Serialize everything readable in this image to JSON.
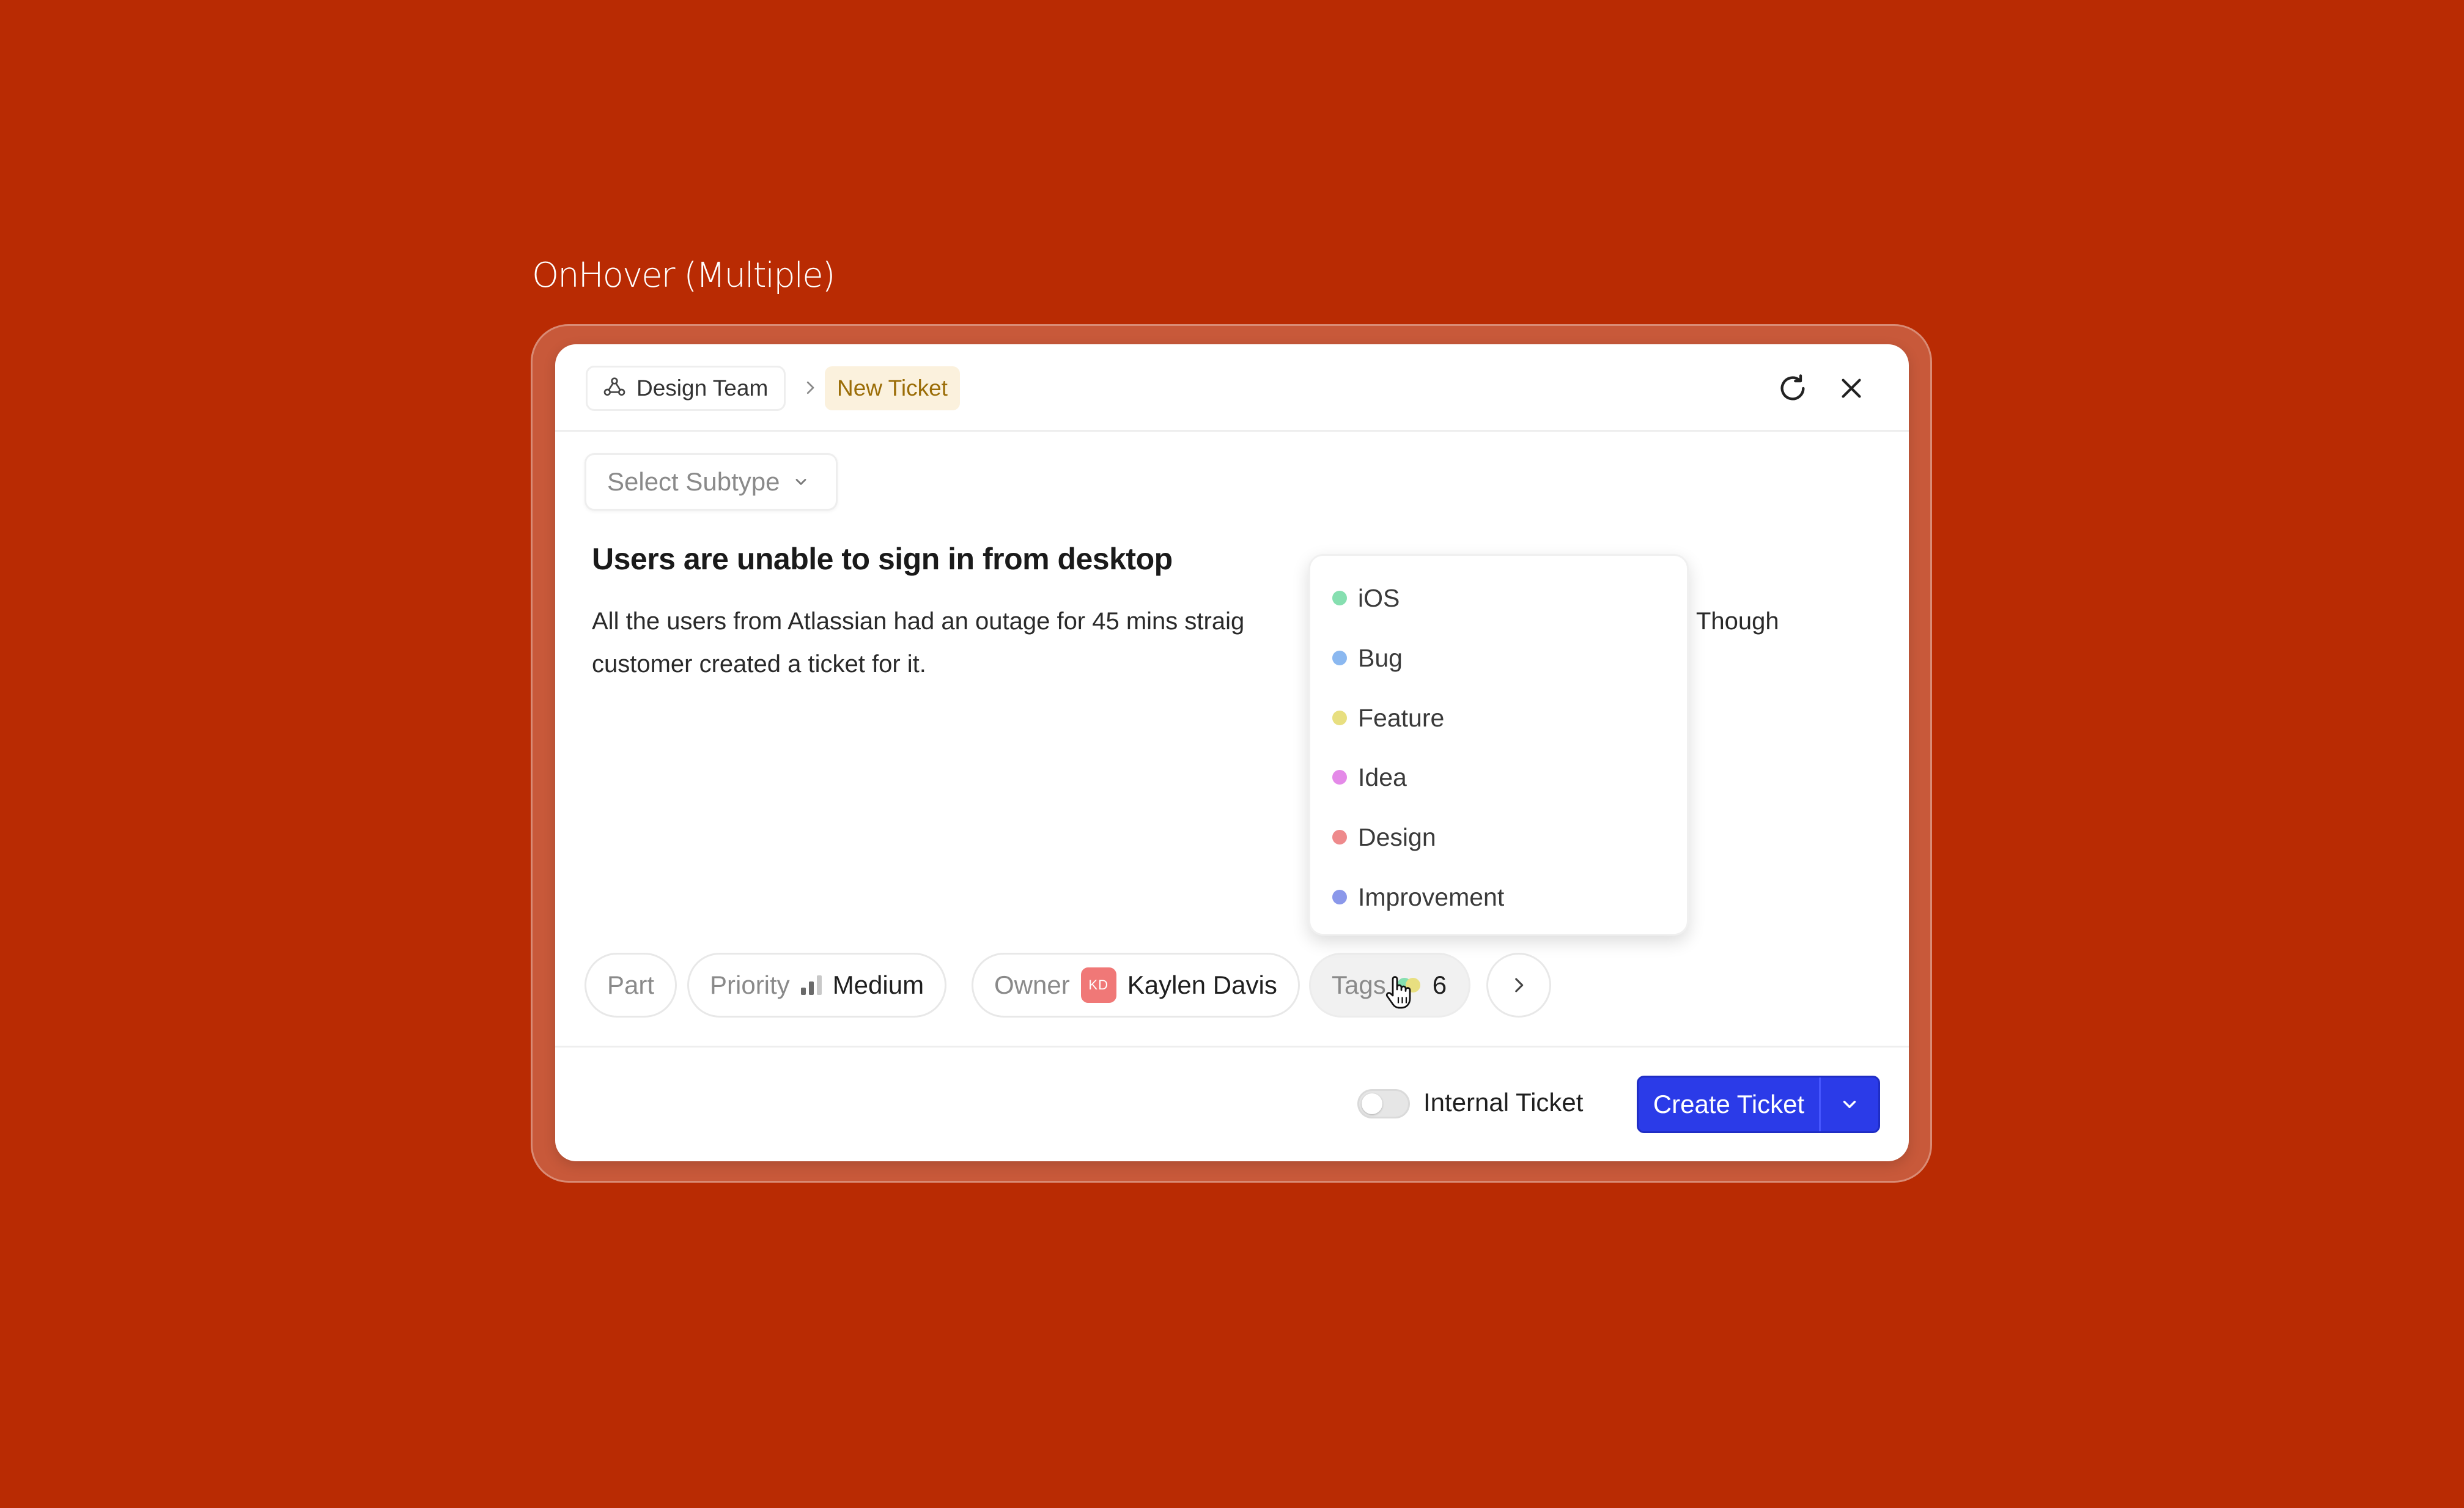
{
  "page_label": "OnHover (Multiple)",
  "header": {
    "team_label": "Design Team",
    "new_ticket_label": "New Ticket",
    "icons": [
      "team-icon",
      "chevron-right-icon",
      "refresh-icon",
      "close-icon"
    ]
  },
  "subtype": {
    "placeholder": "Select Subtype"
  },
  "ticket": {
    "title": "Users are unable to sign in from desktop",
    "description_line1": "All the users from Atlassian had an outage for 45 mins straig",
    "description_line1_tail": "Though",
    "description_line2": "customer created a ticket for it."
  },
  "fields": {
    "part_label": "Part",
    "priority_label": "Priority",
    "priority_value": "Medium",
    "owner_label": "Owner",
    "owner_initials": "KD",
    "owner_name": "Kaylen Davis",
    "tags_label": "Tags",
    "tags_count": "6"
  },
  "tags_dropdown": {
    "items": [
      {
        "label": "iOS",
        "color": "#86dfb0"
      },
      {
        "label": "Bug",
        "color": "#8bb8f0"
      },
      {
        "label": "Feature",
        "color": "#e8df80"
      },
      {
        "label": "Idea",
        "color": "#e48ae8"
      },
      {
        "label": "Design",
        "color": "#ee8a8c"
      },
      {
        "label": "Improvement",
        "color": "#8b98ea"
      }
    ]
  },
  "footer": {
    "internal_toggle_label": "Internal Ticket",
    "internal_toggle_on": false,
    "create_label": "Create Ticket"
  },
  "colors": {
    "background": "#b92b03",
    "primary_button": "#2b3be8",
    "new_ticket_badge_bg": "#fbf1dd",
    "new_ticket_badge_text": "#9b6d07",
    "avatar": "#f07877"
  }
}
